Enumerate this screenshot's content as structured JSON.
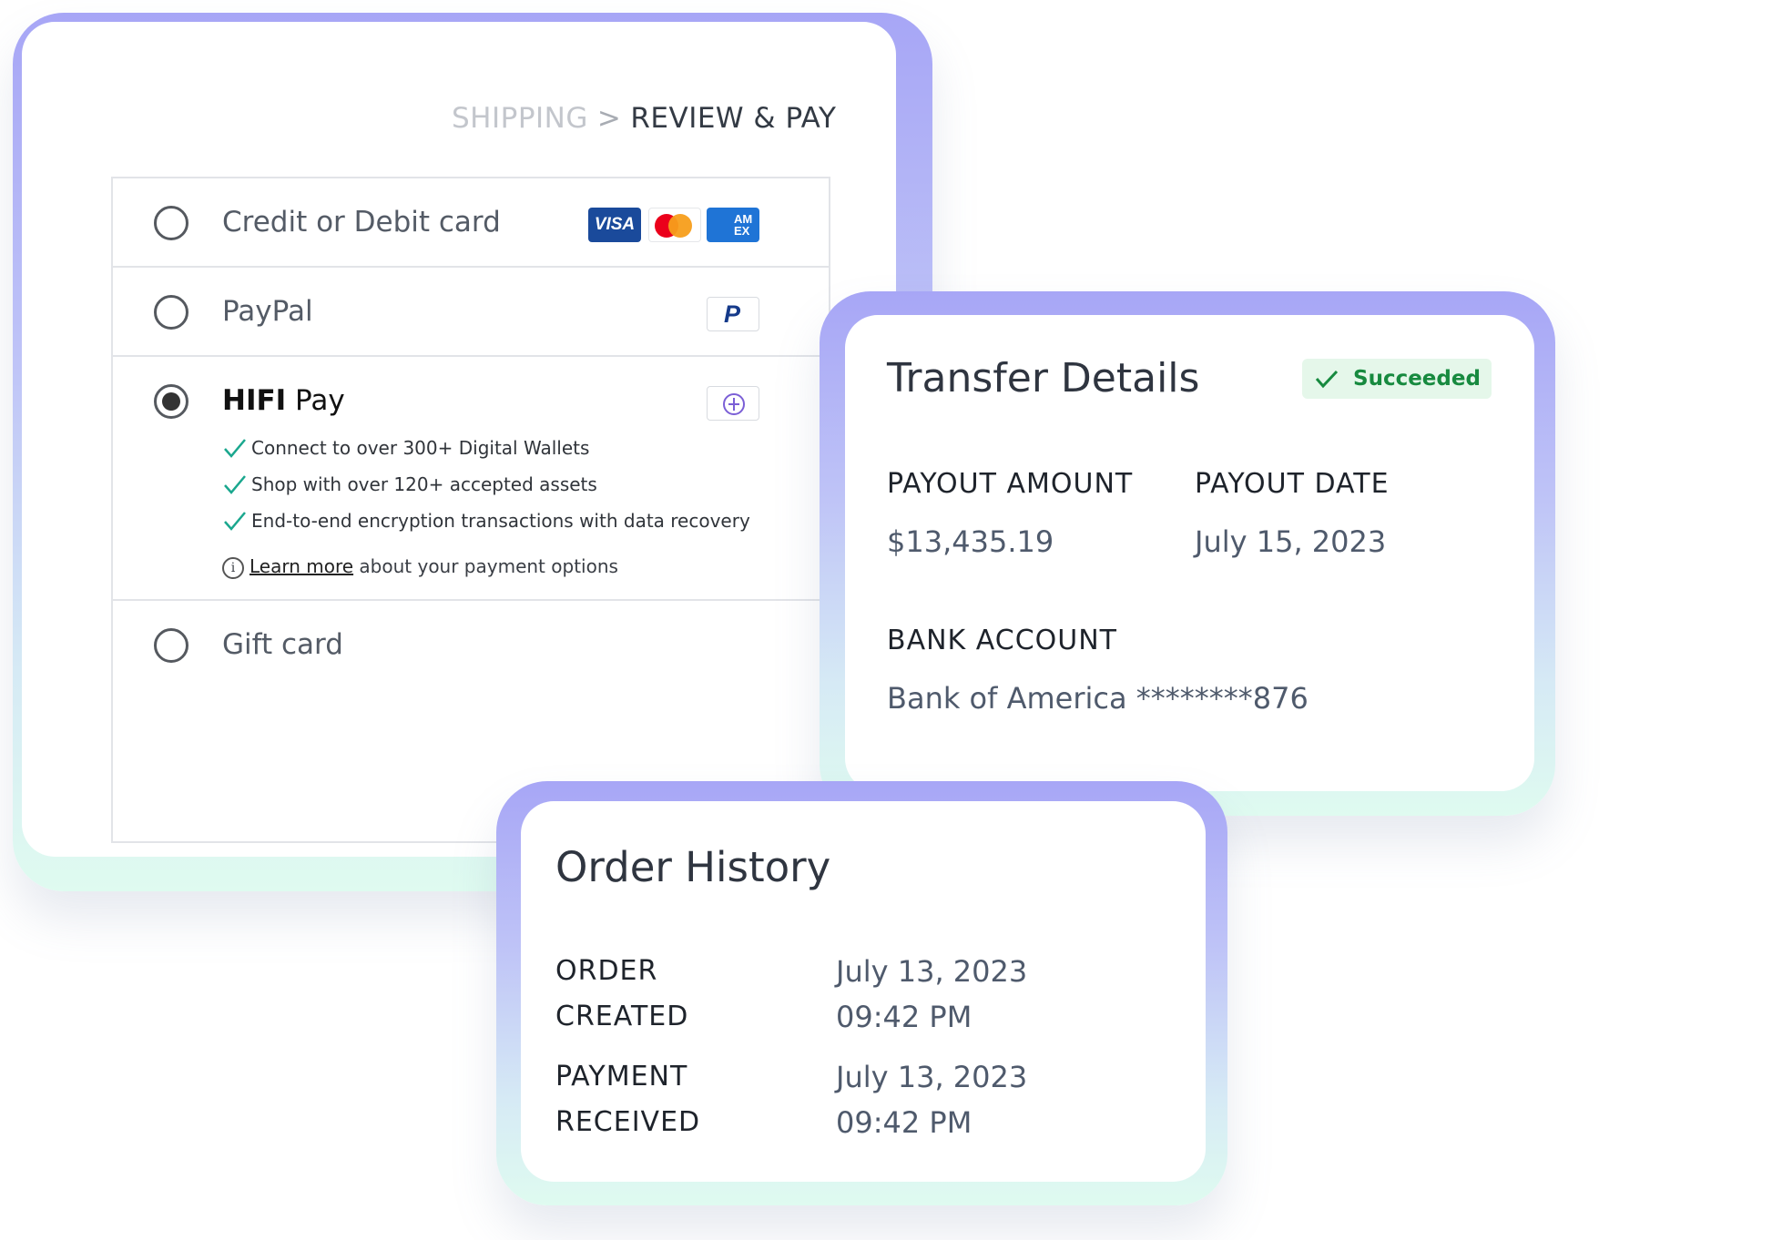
{
  "checkout": {
    "breadcrumb": {
      "step1": "SHIPPING",
      "separator": ">",
      "step2": "REVIEW & PAY"
    },
    "options": [
      {
        "label": "Credit or Debit card",
        "selected": false,
        "logos": [
          "visa-logo",
          "mastercard-logo",
          "amex-logo"
        ]
      },
      {
        "label": "PayPal",
        "selected": false,
        "logos": [
          "paypal-logo"
        ]
      },
      {
        "label_brand": "HIFI",
        "label_rest": " Pay",
        "selected": true,
        "logos": [
          "hifi-logo"
        ]
      },
      {
        "label": "Gift card",
        "selected": false,
        "logos": []
      }
    ],
    "logos": {
      "visa": "VISA",
      "amex_line1": "AM",
      "amex_line2": "EX",
      "paypal": "P"
    },
    "hifi_features": [
      "Connect to over 300+ Digital Wallets",
      "Shop with over 120+ accepted assets",
      "End-to-end encryption transactions with data recovery"
    ],
    "learn_more": {
      "icon": "i",
      "link": "Learn more",
      "rest": " about your payment options"
    }
  },
  "transfer": {
    "title": "Transfer Details",
    "status": "Succeeded",
    "payout_amount_label": "PAYOUT AMOUNT",
    "payout_amount": "$13,435.19",
    "payout_date_label": "PAYOUT DATE",
    "payout_date": "July 15, 2023",
    "bank_account_label": "BANK ACCOUNT",
    "bank_account": "Bank of America ********876"
  },
  "order": {
    "title": "Order History",
    "rows": [
      {
        "label_line1": "ORDER CREATED",
        "label_line2": "",
        "date": "July 13, 2023",
        "time": "09:42 PM"
      },
      {
        "label_line1": "PAYMENT",
        "label_line2": "RECEIVED",
        "date": "July 13, 2023",
        "time": "09:42 PM"
      }
    ]
  },
  "colors": {
    "accent_purple": "#a7a6f6",
    "accent_mint": "#dffbf0",
    "success_green": "#178a3f",
    "check_teal": "#1aa78e"
  }
}
